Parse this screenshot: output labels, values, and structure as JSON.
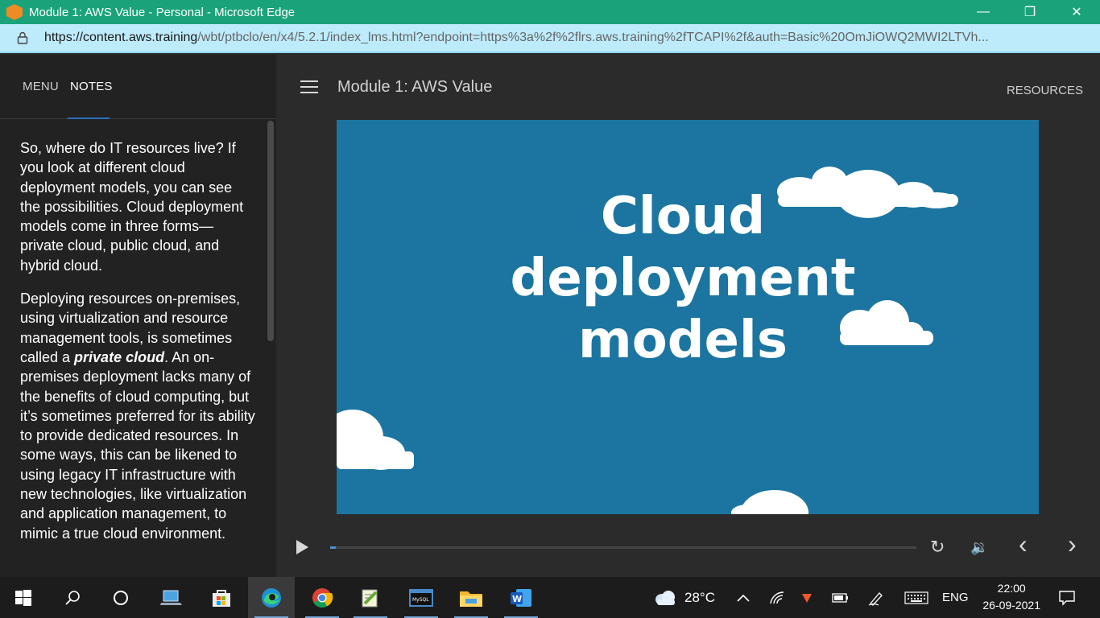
{
  "window": {
    "title": "Module 1: AWS Value - Personal - Microsoft Edge",
    "minimize": "—",
    "maximize": "❐",
    "close": "✕"
  },
  "address": {
    "url_host": "https://content.aws.training",
    "url_rest": "/wbt/ptbclo/en/x4/5.2.1/index_lms.html?endpoint=https%3a%2f%2flrs.aws.training%2fTCAPI%2f&auth=Basic%20OmJiOWQ2MWI2LTVh..."
  },
  "sidebar": {
    "tabs": [
      {
        "label": "MENU"
      },
      {
        "label": "NOTES"
      }
    ],
    "notes": {
      "p1": "So, where do IT resources live? If you look at different cloud deployment models, you can see the possibilities. Cloud deployment models come in three forms—private cloud, public cloud, and hybrid cloud.",
      "p2_before": "Deploying resources on-premises, using virtualization and resource management tools, is sometimes called a ",
      "p2_italic": "private cloud",
      "p2_after": ". An on-premises deployment lacks many of the benefits of cloud computing, but it’s sometimes preferred for its ability to provide dedicated resources. In some ways, this can be likened to using legacy IT infrastructure with new technologies, like virtualization and application management, to mimic a true cloud environment."
    }
  },
  "header": {
    "course_title": "Module 1: AWS Value",
    "resources_label": "RESOURCES"
  },
  "video": {
    "line1": "Cloud",
    "line2": "deployment",
    "line3": "models",
    "progress_fraction": 0.01
  },
  "controls": {
    "replay_icon": "↻",
    "volume_icon": "🔉",
    "prev_icon": "‹",
    "next_icon": "›"
  },
  "taskbar": {
    "weather_temp": "28°C",
    "language": "ENG",
    "time": "22:00",
    "date": "26-09-2021"
  }
}
